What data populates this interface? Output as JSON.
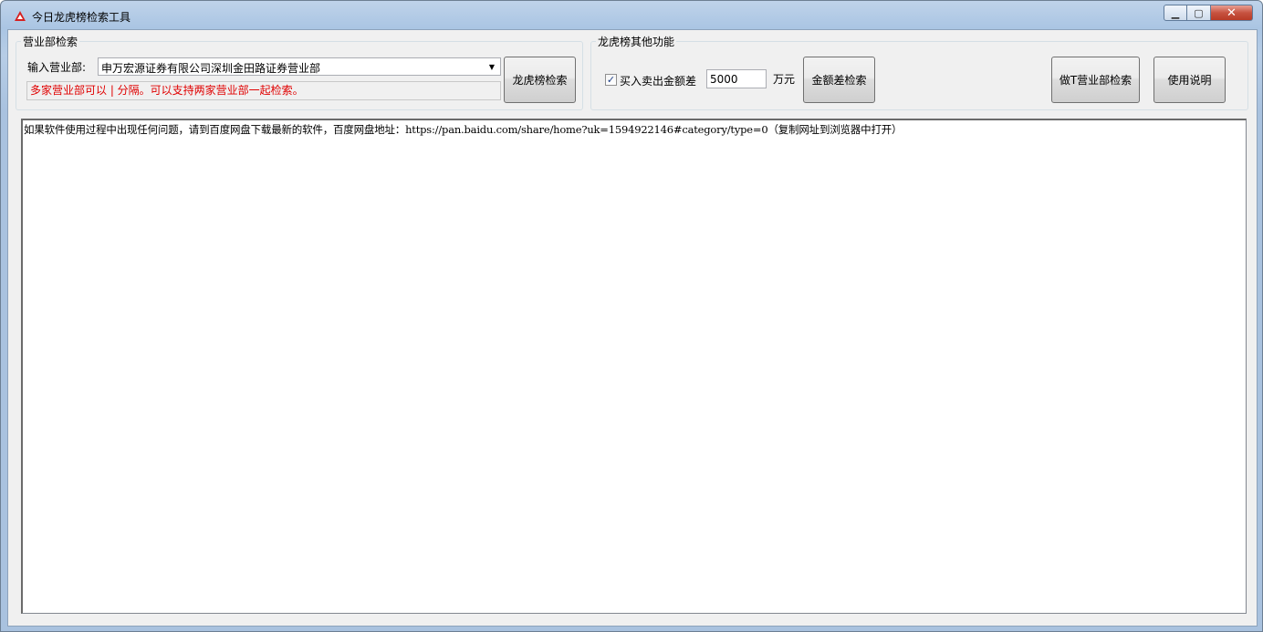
{
  "window": {
    "title": "今日龙虎榜检索工具",
    "close_label": "✕"
  },
  "branch_search": {
    "group_title": "营业部检索",
    "input_label": "输入营业部:",
    "selected_branch": "申万宏源证券有限公司深圳金田路证券营业部",
    "hint": "多家营业部可以 | 分隔。可以支持两家营业部一起检索。",
    "search_button": "龙虎榜检索"
  },
  "other_functions": {
    "group_title": "龙虎榜其他功能",
    "checkbox_label": "买入卖出金额差",
    "checkbox_checked": true,
    "amount_value": "5000",
    "amount_unit": "万元",
    "amount_search_button": "金额差检索",
    "t_branch_button": "做T营业部检索",
    "help_button": "使用说明"
  },
  "log": {
    "text": "如果软件使用过程中出现任何问题，请到百度网盘下载最新的软件，百度网盘地址：https://pan.baidu.com/share/home?uk=1594922146#category/type=0（复制网址到浏览器中打开）"
  },
  "colors": {
    "hint_text": "#e00000",
    "titlebar": "#b9d1ea"
  }
}
